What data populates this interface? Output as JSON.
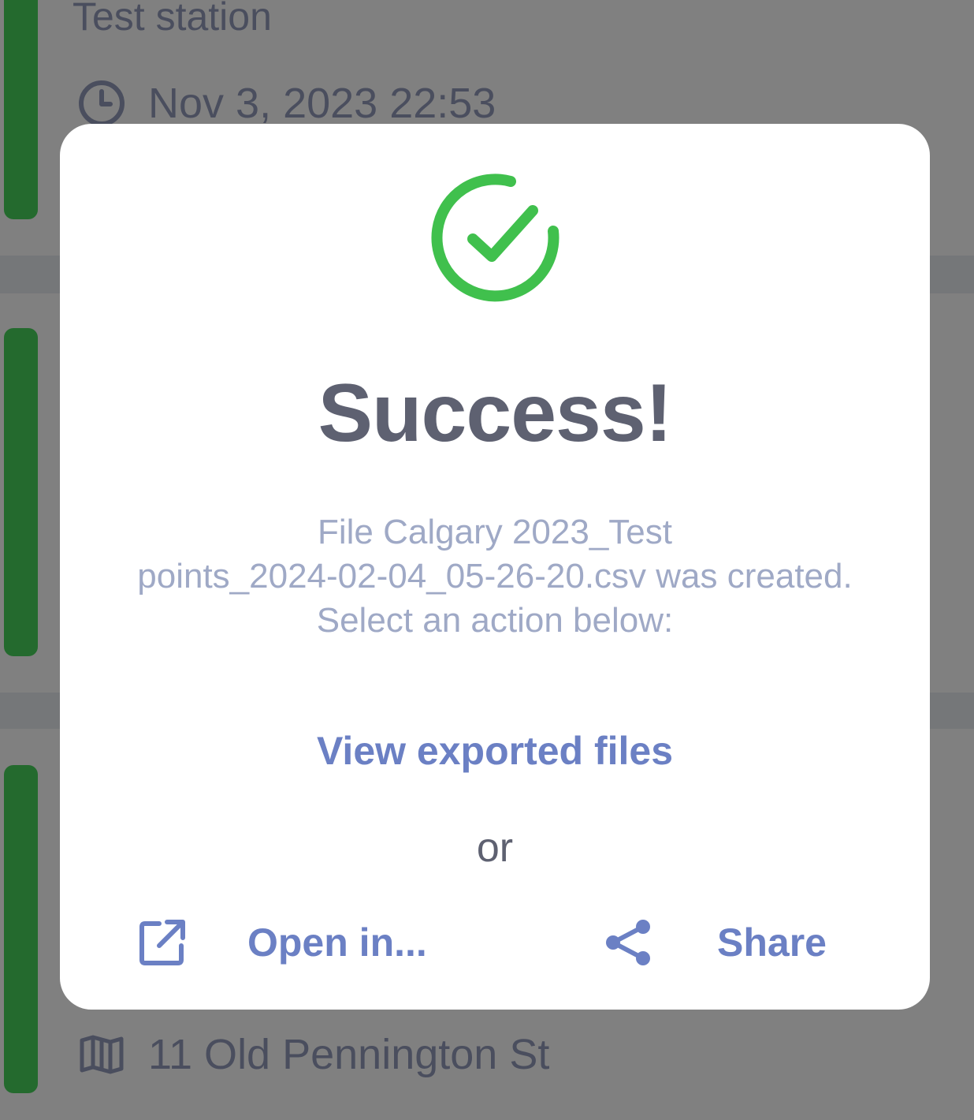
{
  "background": {
    "items": [
      {
        "title": "Test station",
        "time": "Nov 3, 2023 22:53"
      },
      {
        "address": "11 Old Pennington St"
      }
    ]
  },
  "dialog": {
    "title": "Success!",
    "message_lines": [
      "File Calgary 2023_Test",
      "points_2024-02-04_05-26-20.csv was created.",
      "Select an action below:"
    ],
    "view_files_label": "View exported files",
    "or_label": "or",
    "open_in_label": "Open in...",
    "share_label": "Share"
  },
  "colors": {
    "accent": "#6b80c4",
    "success": "#40c04d",
    "title": "#5e6171",
    "message": "#9fa9c6",
    "status_green": "#246a2e",
    "overlay": "#808080"
  },
  "icons": {
    "success": "check-circle-icon",
    "time": "clock-icon",
    "address": "map-icon",
    "open_in": "external-link-icon",
    "share": "share-icon"
  }
}
